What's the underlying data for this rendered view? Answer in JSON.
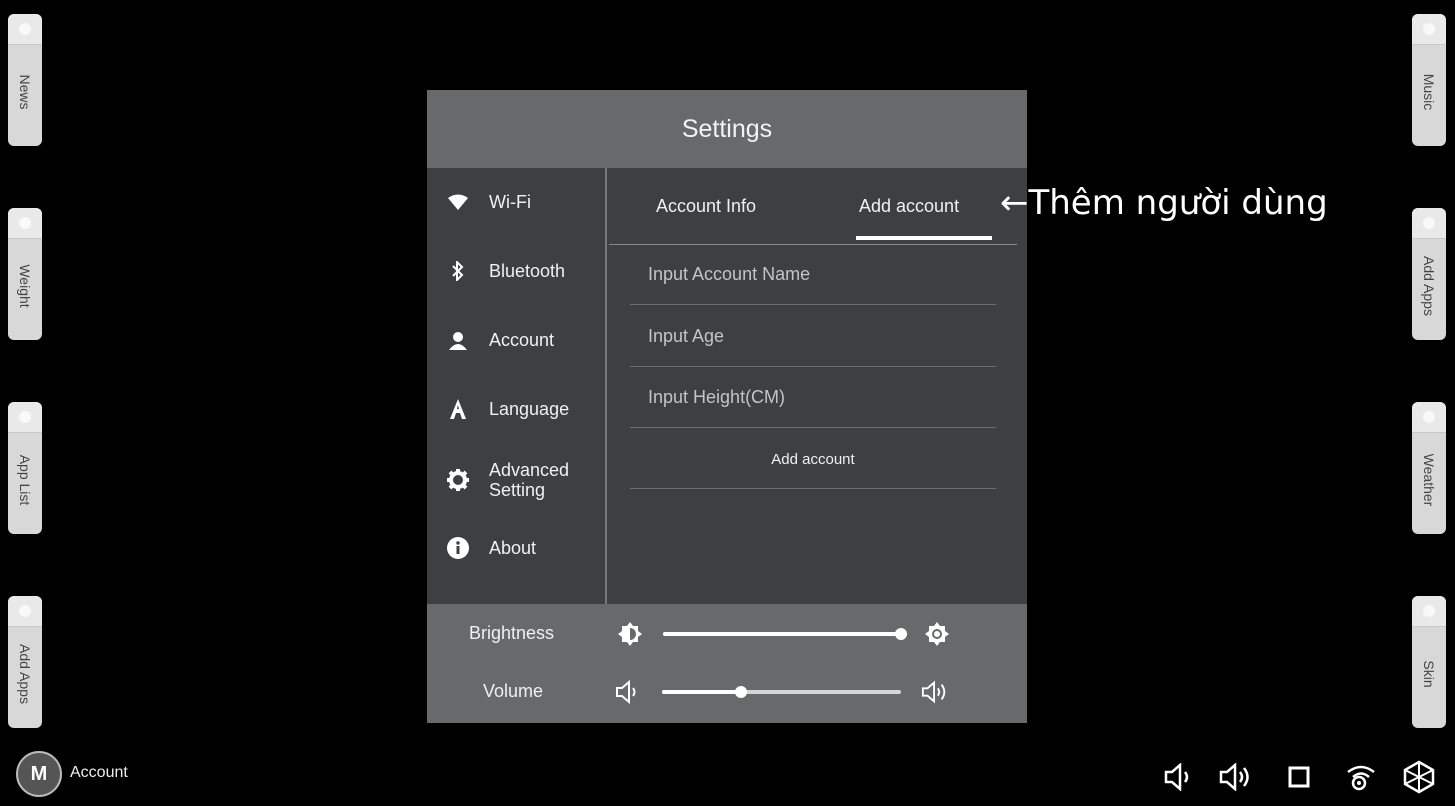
{
  "side_tabs_left": [
    "News",
    "Weight",
    "App List",
    "Add Apps"
  ],
  "side_tabs_right": [
    "Music",
    "Add Apps",
    "Weather",
    "Skin"
  ],
  "settings": {
    "title": "Settings",
    "nav": [
      {
        "label": "Wi-Fi",
        "icon": "wifi-icon"
      },
      {
        "label": "Bluetooth",
        "icon": "bluetooth-icon"
      },
      {
        "label": "Account",
        "icon": "person-icon"
      },
      {
        "label": "Language",
        "icon": "letter-a-icon"
      },
      {
        "label": "Advanced\nSetting",
        "icon": "gear-icon"
      },
      {
        "label": "About",
        "icon": "info-icon"
      }
    ],
    "tabs": [
      "Account Info",
      "Add account"
    ],
    "active_tab": "Add account",
    "fields": {
      "name_placeholder": "Input Account Name",
      "age_placeholder": "Input Age",
      "height_placeholder": "Input Height(CM)"
    },
    "add_button": "Add account",
    "brightness": {
      "label": "Brightness",
      "level": 1.0
    },
    "volume": {
      "label": "Volume",
      "level": 0.33
    }
  },
  "annotation": "←Thêm người dùng",
  "account": {
    "badge_letter": "M",
    "label": "Account"
  },
  "system_icons": [
    "volume-down-icon",
    "volume-up-icon",
    "square-icon",
    "wifi-settings-icon",
    "cube-icon"
  ]
}
